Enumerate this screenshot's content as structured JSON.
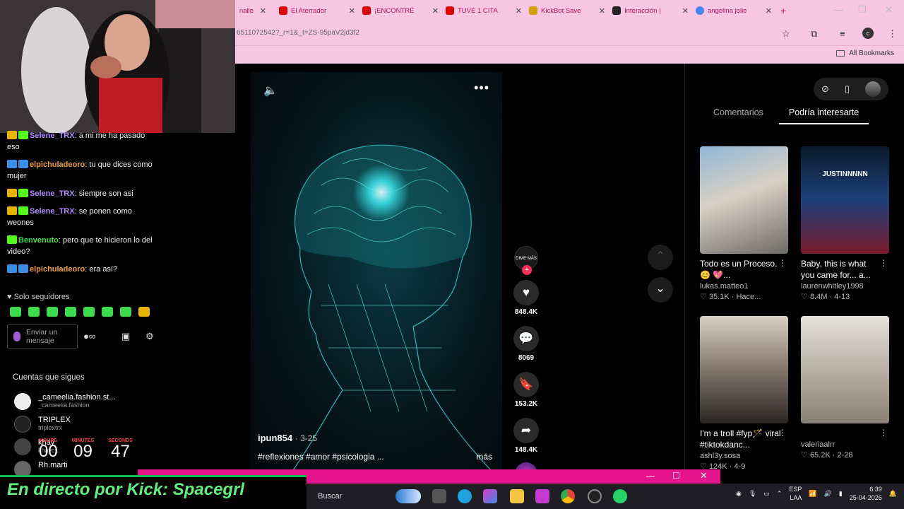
{
  "browser": {
    "tabs": [
      {
        "label": "nalle",
        "color": "#b51060"
      },
      {
        "label": "El Aterrador",
        "color": "#e00000"
      },
      {
        "label": "¡ENCONTRÉ",
        "color": "#e00000"
      },
      {
        "label": "TUVE 1 CITA",
        "color": "#e00000"
      },
      {
        "label": "KickBot Save",
        "color": "#d4a000"
      },
      {
        "label": "Interacción |",
        "color": "#222222"
      },
      {
        "label": "angelina jolie",
        "color": "#4285f4"
      }
    ],
    "url": "6511072542?_r=1&_t=ZS-95paV2jd3f2",
    "profile_initial": "c",
    "all_bookmarks": "All Bookmarks"
  },
  "video": {
    "author": "ipun854",
    "date": "· 3-25",
    "description": "#reflexiones #amor #psicologia ...",
    "more": "más",
    "creator_badge": "DIME MÁS",
    "likes": "848.4K",
    "comments": "8069",
    "saves": "153.2K",
    "shares": "148.4K"
  },
  "side": {
    "tab_comments": "Comentarios",
    "tab_recommended": "Podría interesarte",
    "cards": [
      {
        "title": "Todo es un Proceso. 😊 💖...",
        "user": "lukas.matteo1",
        "likes": "35.1K",
        "time": "Hace..."
      },
      {
        "title": "Baby, this is what you came for... a...",
        "user": "laurenwhitley1998",
        "likes": "8.4M",
        "time": "4-13",
        "overlay": "JUSTINNNNN"
      },
      {
        "title": "I'm a troll #fyp🪄 viral #tiktokdanc...",
        "user": "ashl3y.sosa",
        "likes": "124K",
        "time": "4-9"
      },
      {
        "title": "",
        "user": "valeriaalrr",
        "likes": "65.2K",
        "time": "2-28"
      }
    ]
  },
  "chat": {
    "messages": [
      {
        "user": "Selene_TRX",
        "text": ": a mi me ha pasado eso",
        "color": "#b18cff"
      },
      {
        "user": "elpichuladeoro",
        "text": ": tu que dices como mujer",
        "color": "#f0a030"
      },
      {
        "user": "Selene_TRX",
        "text": ": siempre son asi",
        "color": "#b18cff"
      },
      {
        "user": "Selene_TRX",
        "text": ": se ponen como weones",
        "color": "#b18cff"
      },
      {
        "user": "Benvenuto",
        "text": ": pero que te hicieron lo del video?",
        "color": "#3ddc4c"
      },
      {
        "user": "elpichuladeoro",
        "text": ": era así?",
        "color": "#f0a030"
      }
    ],
    "followers_only": "Solo seguidores",
    "send_placeholder": "Enviar un mensaje"
  },
  "following": {
    "title": "Cuentas que sigues",
    "items": [
      {
        "name": "_cameelia.fashion.st...",
        "sub": "_cameelia.fashion"
      },
      {
        "name": "TRIPLEX",
        "sub": "triplextrx"
      },
      {
        "name": "khay",
        "sub": "khayc..."
      },
      {
        "name": "Rh.marti",
        "sub": ""
      }
    ]
  },
  "timer": {
    "hours_label": "HOURS",
    "hours": "00",
    "minutes_label": "MINUTES",
    "minutes": "09",
    "seconds_label": "SECONDS",
    "seconds": "47"
  },
  "banner": "En directo por Kick: Spacegrl",
  "taskbar": {
    "search": "Buscar",
    "lang": "ESP",
    "lang2": "LAA",
    "time": "6:39",
    "date": "25-04-2026"
  }
}
